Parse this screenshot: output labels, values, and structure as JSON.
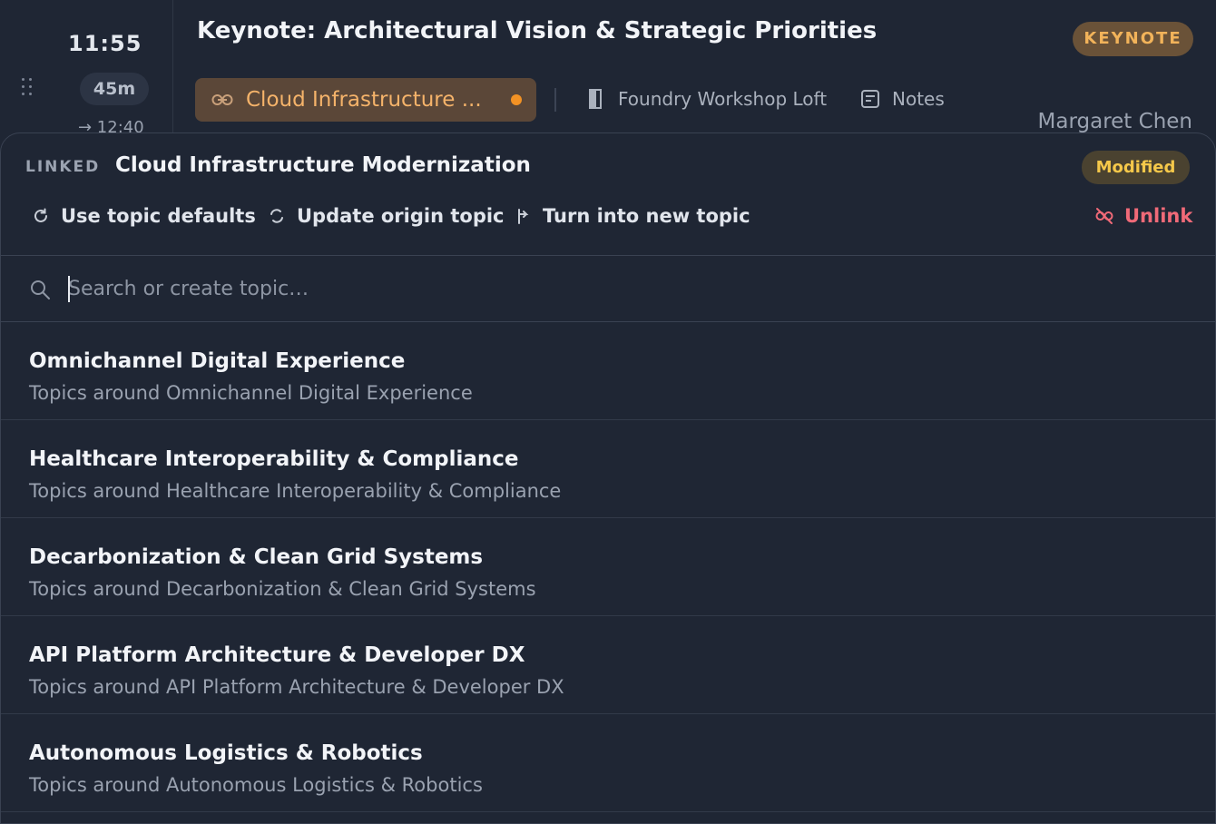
{
  "session": {
    "time": "11:55",
    "duration": "45m",
    "end_time": "→ 12:40",
    "title": "Keynote: Architectural Vision & Strategic Priorities",
    "badge": "KEYNOTE",
    "topic_chip": "Cloud Infrastructure ...",
    "room": "Foundry Workshop Loft",
    "notes_label": "Notes",
    "speaker": "Margaret Chen"
  },
  "popover": {
    "linked_label": "LINKED",
    "linked_topic": "Cloud Infrastructure Modernization",
    "status_badge": "Modified",
    "actions": {
      "use_defaults": "Use topic defaults",
      "update_origin": "Update origin topic",
      "turn_into_new": "Turn into new topic",
      "unlink": "Unlink"
    },
    "search": {
      "placeholder": "Search or create topic…",
      "value": ""
    },
    "topics": [
      {
        "name": "Omnichannel Digital Experience",
        "description": "Topics around Omnichannel Digital Experience"
      },
      {
        "name": "Healthcare Interoperability & Compliance",
        "description": "Topics around Healthcare Interoperability & Compliance"
      },
      {
        "name": "Decarbonization & Clean Grid Systems",
        "description": "Topics around Decarbonization & Clean Grid Systems"
      },
      {
        "name": "API Platform Architecture & Developer DX",
        "description": "Topics around API Platform Architecture & Developer DX"
      },
      {
        "name": "Autonomous Logistics & Robotics",
        "description": "Topics around Autonomous Logistics & Robotics"
      }
    ]
  },
  "colors": {
    "background": "#1f2634",
    "accent_orange": "#f39224",
    "keynote_text": "#f2b35a",
    "modified_text": "#f5c84a",
    "unlink_red": "#f06a78"
  },
  "icons": {
    "drag": "drag-handle-icon",
    "chip": "link-icon",
    "room": "door-icon",
    "notes": "notes-icon",
    "use_defaults": "refresh-icon",
    "update_origin": "sync-icon",
    "turn_into_new": "branch-icon",
    "unlink": "unlink-icon",
    "search": "search-icon"
  }
}
